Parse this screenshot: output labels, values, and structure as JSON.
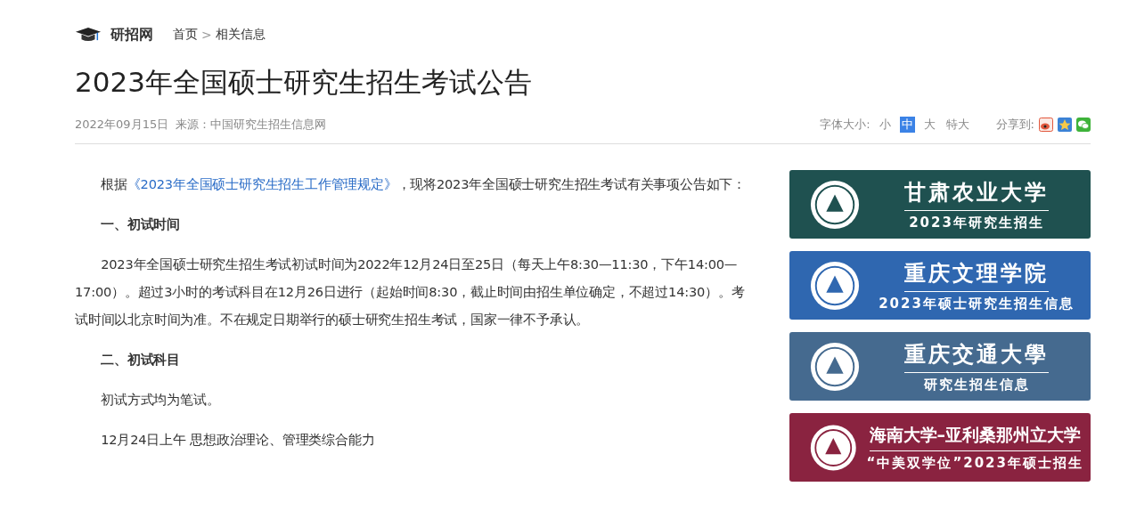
{
  "header": {
    "logo": "研招网",
    "breadcrumb": [
      {
        "label": "首页"
      },
      {
        "label": ">"
      },
      {
        "label": "相关信息"
      }
    ]
  },
  "title": "2023年全国硕士研究生招生考试公告",
  "meta": {
    "date": "2022年09月15日",
    "source": "来源：中国研究生招生信息网",
    "font_size_label": "字体大小:",
    "font_sizes": [
      {
        "label": "小",
        "selected": false
      },
      {
        "label": "中",
        "selected": true
      },
      {
        "label": "大",
        "selected": false
      },
      {
        "label": "特大",
        "selected": false
      }
    ],
    "share_label": "分享到:",
    "share": [
      {
        "kind": "weibo"
      },
      {
        "kind": "qzone"
      },
      {
        "kind": "wechat"
      }
    ]
  },
  "article": [
    {
      "kind": "link_text",
      "before": "根据",
      "link": "《2023年全国硕士研究生招生工作管理规定》",
      "after": "，现将2023年全国硕士研究生招生考试有关事项公告如下："
    },
    {
      "kind": "heading",
      "text": "一、初试时间"
    },
    {
      "kind": "text",
      "text": "2023年全国硕士研究生招生考试初试时间为2022年12月24日至25日（每天上午8:30—11:30，下午14:00—17:00）。超过3小时的考试科目在12月26日进行（起始时间8:30，截止时间由招生单位确定，不超过14:30）。考试时间以北京时间为准。不在规定日期举行的硕士研究生招生考试，国家一律不予承认。"
    },
    {
      "kind": "heading",
      "text": "二、初试科目"
    },
    {
      "kind": "text",
      "text": "初试方式均为笔试。"
    },
    {
      "kind": "text",
      "text": "12月24日上午 思想政治理论、管理类综合能力"
    }
  ],
  "banners": [
    {
      "title": "甘肃农业大学",
      "subtitle": "2023年研究生招生",
      "color": "#1f5150"
    },
    {
      "title": "重庆文理学院",
      "subtitle": "2023年硕士研究生招生信息",
      "color": "#2f67b0"
    },
    {
      "title": "重庆交通大學",
      "subtitle": "研究生招生信息",
      "color": "#456a8f"
    },
    {
      "title": "海南大学–亚利桑那州立大学",
      "subtitle": "“中美双学位”2023年硕士招生",
      "color": "#8a2340"
    }
  ]
}
